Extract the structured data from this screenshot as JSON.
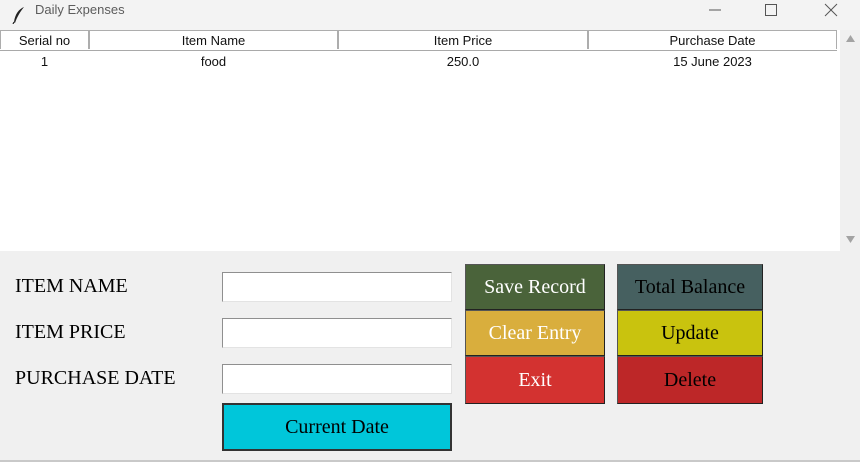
{
  "window": {
    "title": "Daily Expenses",
    "icon": "feather-icon"
  },
  "table": {
    "columns": [
      "Serial no",
      "Item Name",
      "Item Price",
      "Purchase Date"
    ],
    "rows": [
      {
        "serial": "1",
        "item_name": "food",
        "item_price": "250.0",
        "purchase_date": "15 June 2023"
      }
    ]
  },
  "form": {
    "item_name_label": "ITEM NAME",
    "item_price_label": "ITEM PRICE",
    "purchase_date_label": "PURCHASE DATE",
    "item_name_value": "",
    "item_price_value": "",
    "purchase_date_value": ""
  },
  "buttons": {
    "save": "Save Record",
    "clear": "Clear Entry",
    "exit": "Exit",
    "total": "Total Balance",
    "update": "Update",
    "delete": "Delete",
    "current_date": "Current Date"
  },
  "colors": {
    "save": "#4a633a",
    "clear": "#d9ae3d",
    "exit": "#d33230",
    "total": "#466060",
    "update": "#c9c30e",
    "delete": "#bd2728",
    "current_date": "#00c6da"
  }
}
